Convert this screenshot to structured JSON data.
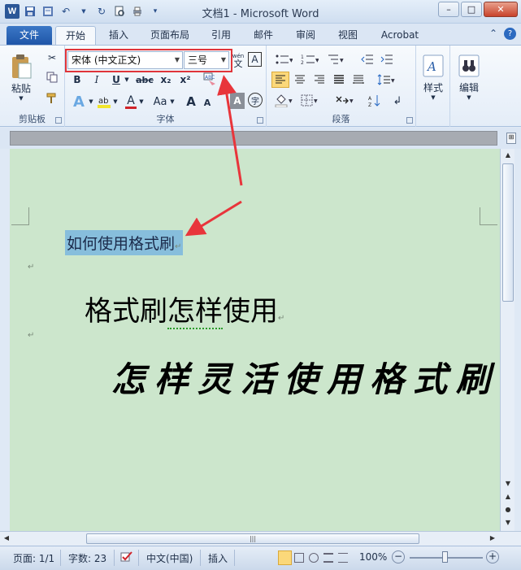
{
  "window": {
    "title": "文档1 - Microsoft Word",
    "min_label": "–",
    "max_label": "□",
    "close_label": "✕"
  },
  "qat": {
    "logo": "W",
    "save_icon": "save-icon",
    "undo_icon": "undo-icon",
    "redo_icon": "redo-icon",
    "print_icon": "print-preview-icon",
    "more_icon": "customize-icon"
  },
  "tabs": [
    {
      "label": "文件"
    },
    {
      "label": "开始"
    },
    {
      "label": "插入"
    },
    {
      "label": "页面布局"
    },
    {
      "label": "引用"
    },
    {
      "label": "邮件"
    },
    {
      "label": "审阅"
    },
    {
      "label": "视图"
    },
    {
      "label": "Acrobat"
    }
  ],
  "ribbon": {
    "clipboard": {
      "paste_label": "粘贴",
      "group_label": "剪贴板"
    },
    "font": {
      "font_name": "宋体 (中文正文)",
      "font_size": "三号",
      "group_label": "字体",
      "bold": "B",
      "italic": "I",
      "underline": "U",
      "strike": "abc",
      "subscript": "x₂",
      "superscript": "x²",
      "text_color": "A",
      "change_case": "Aa",
      "grow": "A",
      "shrink": "A",
      "char_border": "A",
      "enclose": "字",
      "phonetic": "wén",
      "font_a": "A"
    },
    "paragraph": {
      "group_label": "段落"
    },
    "styles": {
      "label": "样式"
    },
    "editing": {
      "label": "编辑"
    }
  },
  "document": {
    "line1": "如何使用格式刷",
    "line2_a": "格式刷",
    "line2_b": "怎样",
    "line2_c": "使用",
    "line3": "怎样灵活使用格式刷",
    "para_mark": "↵"
  },
  "status": {
    "page": "页面: 1/1",
    "words": "字数: 23",
    "language": "中文(中国)",
    "mode": "插入",
    "zoom": "100%",
    "zoom_out": "−",
    "zoom_in": "+"
  },
  "colors": {
    "accent": "#1f56a8",
    "highlight_box": "#e0343a",
    "doc_bg": "#cce6cc",
    "selection": "#87bedc"
  }
}
